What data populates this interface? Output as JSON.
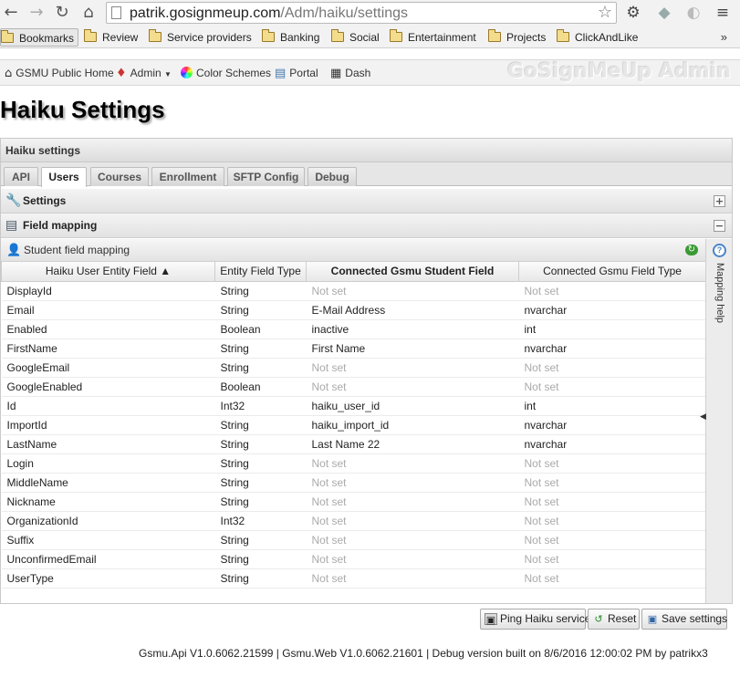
{
  "browser": {
    "url_host": "patrik.gosignmeup.com",
    "url_path": "/Adm/haiku/settings",
    "bookmarks": [
      "Bookmarks",
      "Review",
      "Service providers",
      "Banking",
      "Social",
      "Entertainment",
      "Projects",
      "ClickAndLike"
    ],
    "more": "»"
  },
  "toolbar": {
    "items": [
      "GSMU Public Home",
      "Admin",
      "Color Schemes",
      "Portal",
      "Dash"
    ],
    "brand": "GoSignMeUp Admin"
  },
  "page": {
    "title": "Haiku Settings"
  },
  "panel": {
    "title": "Haiku settings",
    "tabs": [
      "API",
      "Users",
      "Courses",
      "Enrollment",
      "SFTP Config",
      "Debug"
    ],
    "active_tab": "Users",
    "settings_label": "Settings",
    "field_mapping_label": "Field mapping",
    "grid_title": "Student field mapping",
    "help_label": "Mapping help",
    "columns": [
      "Haiku User Entity Field ▲",
      "Entity Field Type",
      "Connected Gsmu Student Field",
      "Connected Gsmu Field Type"
    ],
    "rows": [
      {
        "field": "DisplayId",
        "type": "String",
        "gsmu_field": "Not set",
        "gsmu_type": "Not set"
      },
      {
        "field": "Email",
        "type": "String",
        "gsmu_field": "E-Mail Address",
        "gsmu_type": "nvarchar"
      },
      {
        "field": "Enabled",
        "type": "Boolean",
        "gsmu_field": "inactive",
        "gsmu_type": "int"
      },
      {
        "field": "FirstName",
        "type": "String",
        "gsmu_field": "First Name",
        "gsmu_type": "nvarchar"
      },
      {
        "field": "GoogleEmail",
        "type": "String",
        "gsmu_field": "Not set",
        "gsmu_type": "Not set"
      },
      {
        "field": "GoogleEnabled",
        "type": "Boolean",
        "gsmu_field": "Not set",
        "gsmu_type": "Not set"
      },
      {
        "field": "Id",
        "type": "Int32",
        "gsmu_field": "haiku_user_id",
        "gsmu_type": "int"
      },
      {
        "field": "ImportId",
        "type": "String",
        "gsmu_field": "haiku_import_id",
        "gsmu_type": "nvarchar"
      },
      {
        "field": "LastName",
        "type": "String",
        "gsmu_field": "Last Name 22",
        "gsmu_type": "nvarchar"
      },
      {
        "field": "Login",
        "type": "String",
        "gsmu_field": "Not set",
        "gsmu_type": "Not set"
      },
      {
        "field": "MiddleName",
        "type": "String",
        "gsmu_field": "Not set",
        "gsmu_type": "Not set"
      },
      {
        "field": "Nickname",
        "type": "String",
        "gsmu_field": "Not set",
        "gsmu_type": "Not set"
      },
      {
        "field": "OrganizationId",
        "type": "Int32",
        "gsmu_field": "Not set",
        "gsmu_type": "Not set"
      },
      {
        "field": "Suffix",
        "type": "String",
        "gsmu_field": "Not set",
        "gsmu_type": "Not set"
      },
      {
        "field": "UnconfirmedEmail",
        "type": "String",
        "gsmu_field": "Not set",
        "gsmu_type": "Not set"
      },
      {
        "field": "UserType",
        "type": "String",
        "gsmu_field": "Not set",
        "gsmu_type": "Not set"
      }
    ]
  },
  "buttons": {
    "ping": "Ping Haiku service",
    "reset": "Reset",
    "save": "Save settings"
  },
  "footer": "Gsmu.Api V1.0.6062.21599 | Gsmu.Web V1.0.6062.21601 | Debug version built on 8/6/2016 12:00:02 PM by patrikx3",
  "icons": [
    "back-icon",
    "forward-icon",
    "reload-icon",
    "home-icon",
    "star-icon",
    "gear-icon",
    "dropbox-icon",
    "extension-icon",
    "folder-icon",
    "house-icon",
    "gem-icon",
    "color-wheel-icon",
    "portal-icon",
    "dash-icon",
    "wrench-icon",
    "field-mapping-icon",
    "user-icon",
    "refresh-icon",
    "help-icon",
    "ping-icon",
    "reset-icon",
    "save-icon"
  ]
}
